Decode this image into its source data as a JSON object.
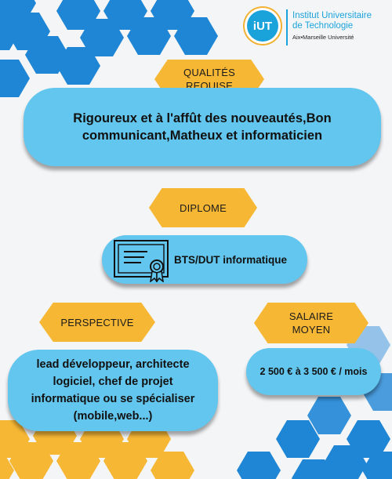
{
  "logo": {
    "mark": "iUT",
    "line1": "Institut Universitaire",
    "line2": "de Technologie",
    "line3": "Aix•Marseille Université"
  },
  "sections": {
    "qualites": {
      "label_line1": "QUALITÉS",
      "label_line2": "REQUISE",
      "content_line1": "Rigoureux et à l'affût des nouveautés,Bon",
      "content_line2": "communicant,Matheux et informaticien"
    },
    "diplome": {
      "label": "DIPLOME",
      "content": "BTS/DUT informatique"
    },
    "perspective": {
      "label": "PERSPECTIVE",
      "content_line1": "lead développeur, architecte",
      "content_line2": "logiciel, chef de projet",
      "content_line3": "informatique ou se spécialiser",
      "content_line4": "(mobile,web...)"
    },
    "salaire": {
      "label_line1": "SALAIRE",
      "label_line2": "MOYEN",
      "content": "2 500 € à 3 500 € / mois"
    }
  },
  "colors": {
    "hex_blue": "#1f86d6",
    "hex_yellow": "#f6b735",
    "pill_blue": "#63c6ee",
    "tag_yellow": "#f6b735"
  }
}
